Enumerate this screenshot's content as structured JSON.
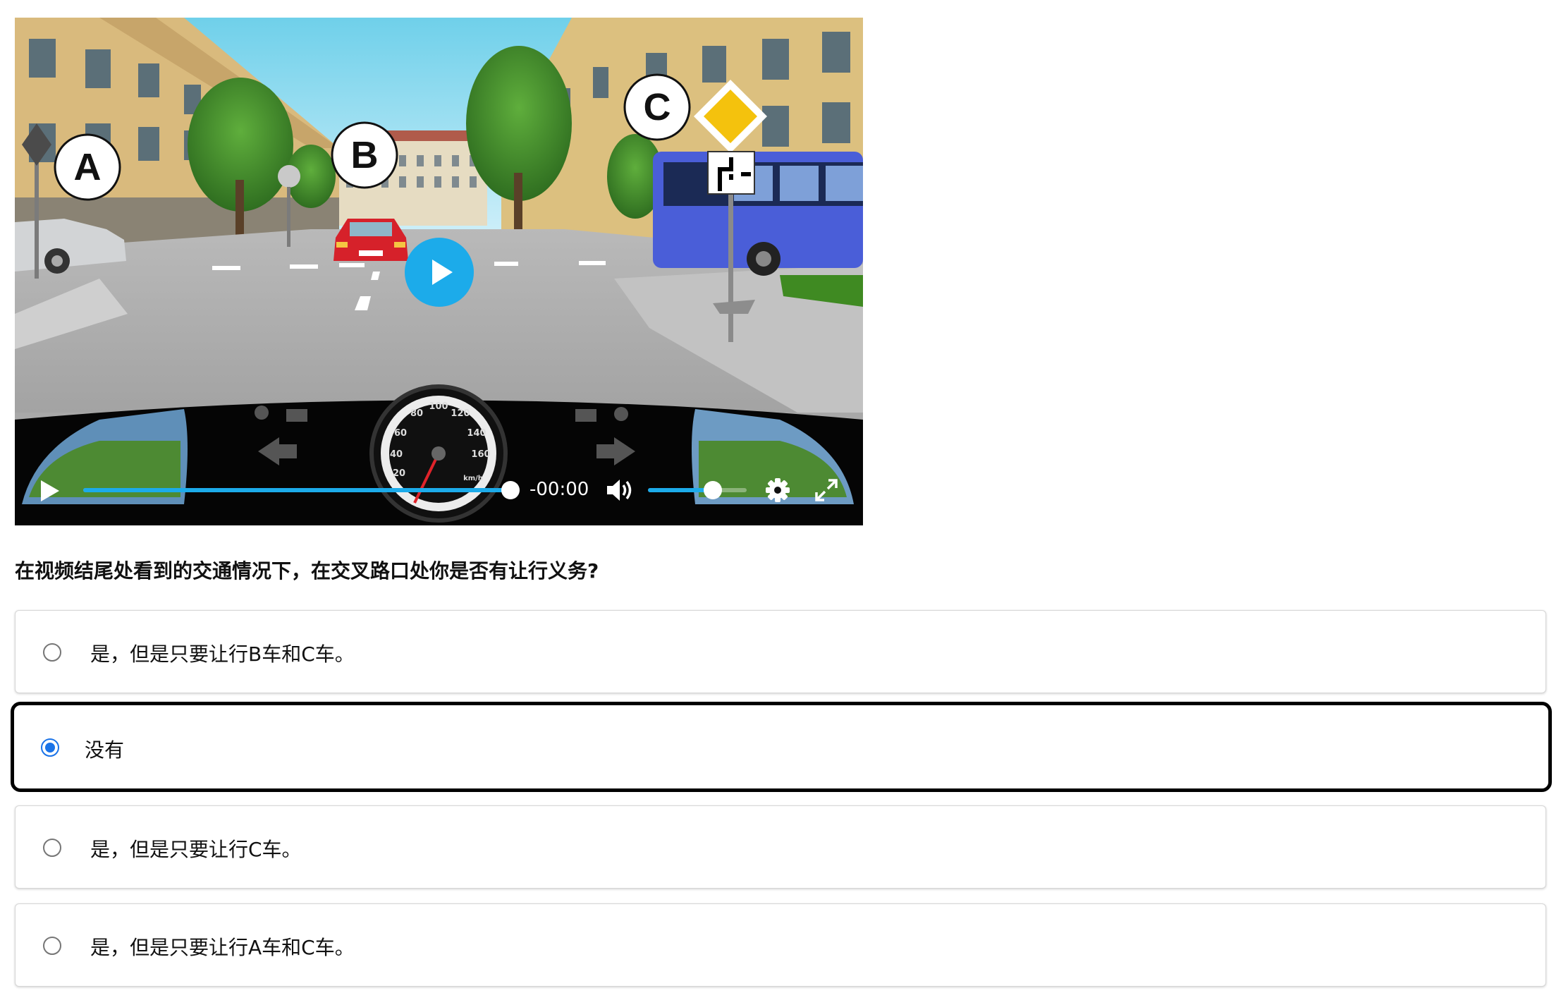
{
  "video": {
    "markers": [
      "A",
      "B",
      "C"
    ],
    "speed_ticks": [
      "20",
      "40",
      "60",
      "80",
      "100",
      "120",
      "140",
      "160"
    ],
    "speed_unit": "km/h",
    "time_display": "-00:00",
    "progress": 1.0,
    "volume": 0.66
  },
  "question": "在视频结尾处看到的交通情况下，在交叉路口处你是否有让行义务?",
  "options": [
    {
      "label": "是，但是只要让行B车和C车。",
      "selected": false
    },
    {
      "label": "没有",
      "selected": true
    },
    {
      "label": "是，但是只要让行C车。",
      "selected": false
    },
    {
      "label": "是，但是只要让行A车和C车。",
      "selected": false
    }
  ],
  "colors": {
    "accent": "#1cabea",
    "radio_selected": "#1a73e8",
    "sign_yellow": "#f4c20d",
    "bus_blue": "#4a5ed8",
    "car_red": "#d6212a"
  },
  "icons": {
    "big_play": "play-icon",
    "play": "play-icon",
    "volume": "volume-icon",
    "settings": "gear-icon",
    "fullscreen": "fullscreen-icon"
  }
}
